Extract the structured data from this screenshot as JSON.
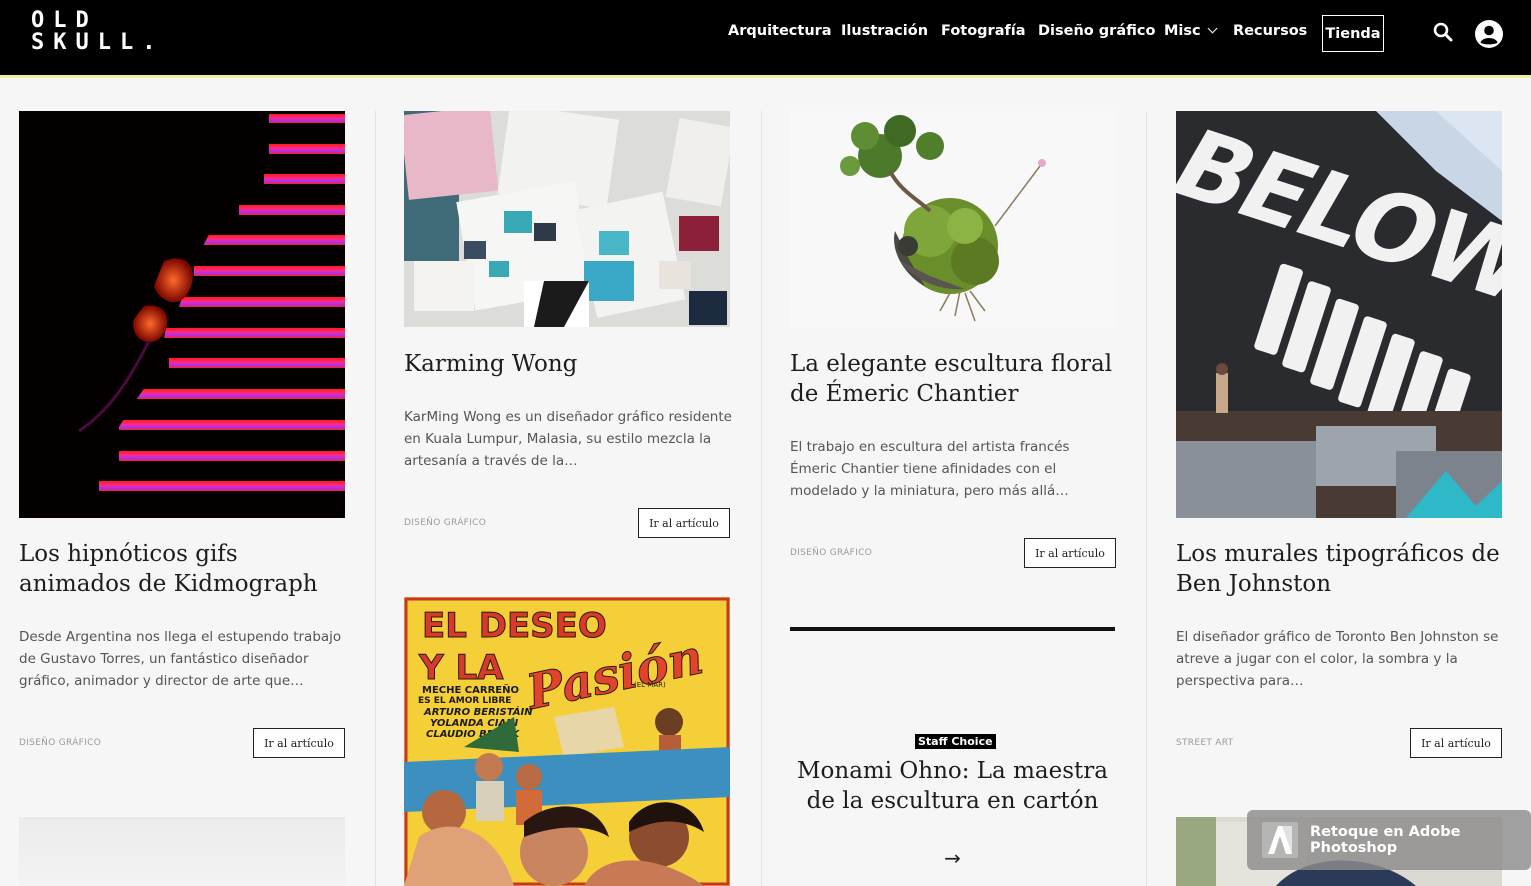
{
  "header": {
    "logo_line1": "OLD",
    "logo_line2": "SKULL.",
    "nav": [
      "Arquitectura",
      "Ilustración",
      "Fotografía",
      "Diseño gráfico",
      "Misc",
      "Recursos"
    ],
    "shop_label": "Tienda",
    "icons": [
      "search-icon",
      "user-account-icon",
      "chevron-down-icon"
    ]
  },
  "cards": [
    {
      "title": "Los hipnóticos gifs animados de Kidmograph",
      "excerpt": "Desde Argentina nos llega el estupendo trabajo de  Gustavo Torres, un fantástico diseñador gráfico, animador y director de arte que…",
      "category": "DISEÑO GRÁFICO",
      "button": "Ir al artículo"
    },
    {
      "title": "Karming Wong",
      "excerpt": "KarMing Wong es un diseñador gráfico residente en Kuala Lumpur, Malasia, su estilo mezcla la artesanía a través de la…",
      "category": "DISEÑO GRÁFICO",
      "button": "Ir al artículo"
    },
    {
      "title": "La elegante escultura floral de Émeric Chantier",
      "excerpt": "El trabajo en escultura del artista francés Émeric Chantier tiene afinidades con el modelado y la miniatura, pero más allá…",
      "category": "DISEÑO GRÁFICO",
      "button": "Ir al artículo"
    },
    {
      "title": "Los murales tipográficos de Ben Johnston",
      "excerpt": "El diseñador gráfico de Toronto Ben Johnston se atreve a  jugar con el color, la sombra y la perspectiva para…",
      "category": "STREET ART",
      "button": "Ir al artículo"
    }
  ],
  "poster": {
    "line1": "EL DESEO",
    "line2": "Y LA",
    "script": "Pasión",
    "credits": [
      "MECHE CARREÑO",
      "ES EL AMOR LIBRE",
      "ARTURO BERISTÁIN",
      "YOLANDA CIANI",
      "CLAUDIO BROOK"
    ],
    "small": "(EL MAR)"
  },
  "mural_text": "BELOW",
  "staff": {
    "badge": "Staff Choice",
    "title": "Monami Ohno: La maestra de la escultura en cartón",
    "arrow": "→"
  },
  "toast": {
    "label": "Retoque en Adobe Photoshop",
    "icon": "adobe-icon"
  }
}
